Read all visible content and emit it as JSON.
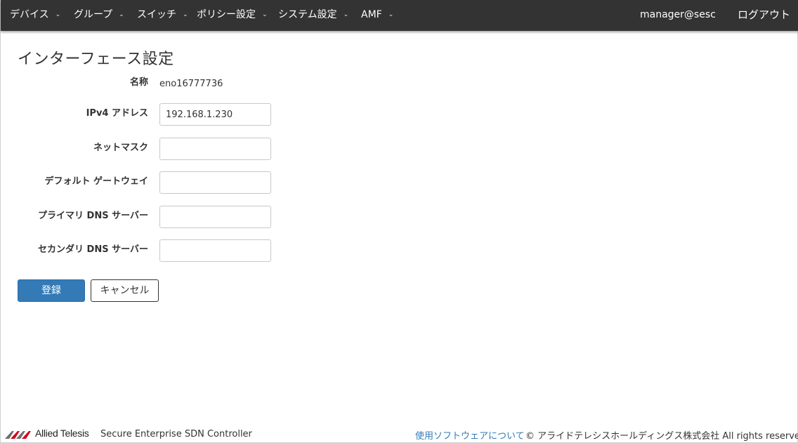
{
  "navbar": {
    "items": [
      {
        "label": "デバイス"
      },
      {
        "label": "グループ"
      },
      {
        "label": "スイッチ"
      },
      {
        "label": "ポリシー設定"
      },
      {
        "label": "システム設定"
      },
      {
        "label": "AMF"
      }
    ],
    "user": "manager@sesc",
    "logout": "ログアウト",
    "caret": "⌄"
  },
  "page": {
    "title": "インターフェース設定"
  },
  "form": {
    "name_label": "名称",
    "name_value": "eno16777736",
    "ipv4_label": "IPv4 アドレス",
    "ipv4_value": "192.168.1.230",
    "netmask_label": "ネットマスク",
    "netmask_value": "",
    "gateway_label": "デフォルト ゲートウェイ",
    "gateway_value": "",
    "dns1_label": "プライマリ DNS サーバー",
    "dns1_value": "",
    "dns2_label": "セカンダリ DNS サーバー",
    "dns2_value": ""
  },
  "actions": {
    "submit_label": "登録",
    "cancel_label": "キャンセル"
  },
  "footer": {
    "logo_text": "Allied Telesis",
    "product": "Secure Enterprise SDN Controller",
    "license_link": "使用ソフトウェアについて",
    "copyright": "© アライドテレシスホールディングス株式会社 All rights reserved."
  },
  "colors": {
    "navbar_bg": "#333333",
    "primary": "#337ab7",
    "logo_red": "#d6001c",
    "logo_gray": "#6e6e6e"
  }
}
